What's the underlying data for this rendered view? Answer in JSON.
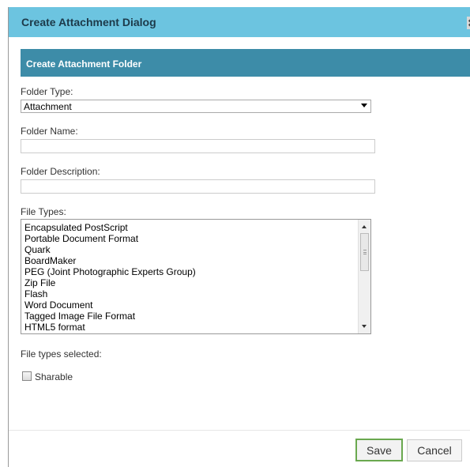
{
  "dialog": {
    "title": "Create Attachment Dialog",
    "close_icon": "close-icon",
    "section_header": "Create Attachment Folder"
  },
  "form": {
    "folder_type_label": "Folder Type:",
    "folder_type_value": "Attachment",
    "folder_name_label": "Folder Name:",
    "folder_name_value": "",
    "folder_description_label": "Folder Description:",
    "folder_description_value": "",
    "file_types_label": "File Types:",
    "file_types": [
      "Encapsulated PostScript",
      "Portable Document Format",
      "Quark",
      "BoardMaker",
      "PEG (Joint Photographic Experts Group)",
      "Zip File",
      "Flash",
      "Word Document",
      "Tagged Image File Format",
      "HTML5 format"
    ],
    "file_types_selected_label": "File types selected:",
    "sharable_label": "Sharable",
    "sharable_checked": false
  },
  "footer": {
    "save_label": "Save",
    "cancel_label": "Cancel"
  },
  "colors": {
    "title_bar": "#6cc4e0",
    "section_header": "#3d8ca8",
    "save_border": "#6aa84f"
  }
}
